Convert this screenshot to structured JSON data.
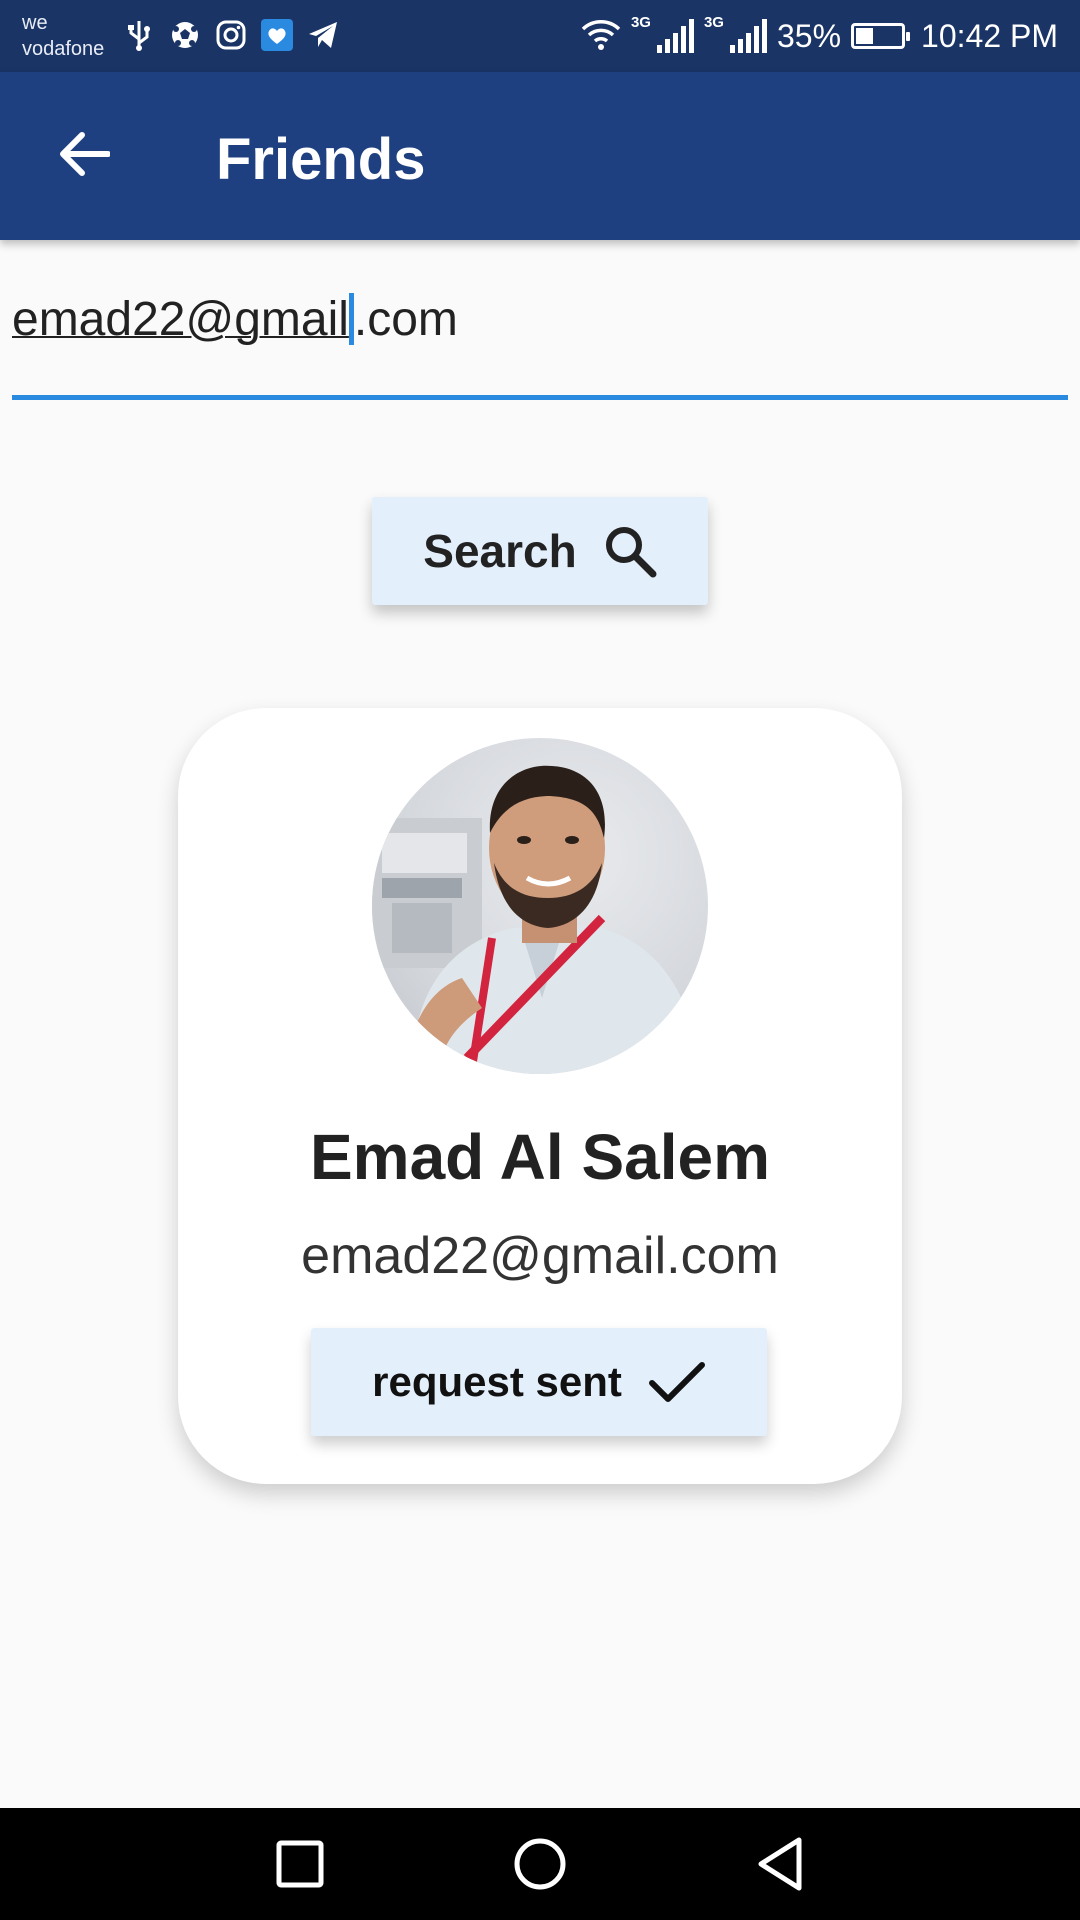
{
  "status_bar": {
    "carrier_line1": "we",
    "carrier_line2": "vodafone",
    "network_type_1": "3G",
    "network_type_2": "3G",
    "battery_percent": "35%",
    "time": "10:42 PM",
    "left_icons": [
      "usb-icon",
      "football-icon",
      "instagram-icon",
      "messenger-icon",
      "telegram-icon"
    ],
    "right_icons": [
      "wifi-icon",
      "signal-icon",
      "signal-icon",
      "battery-icon"
    ]
  },
  "app_bar": {
    "title": "Friends",
    "back_icon": "arrow-back-icon",
    "background": "#1f4080"
  },
  "search": {
    "input_value_linked": "emad22@gmail",
    "input_value_rest": ".com",
    "button_label": "Search",
    "button_icon": "search-icon",
    "underline_color": "#2a8ae0"
  },
  "result_card": {
    "name": "Emad Al Salem",
    "email": "emad22@gmail.com",
    "avatar": "profile-photo",
    "action_label": "request sent",
    "action_icon": "check-icon"
  },
  "nav_bar": {
    "items": [
      "recent-apps-icon",
      "home-icon",
      "back-icon"
    ]
  }
}
